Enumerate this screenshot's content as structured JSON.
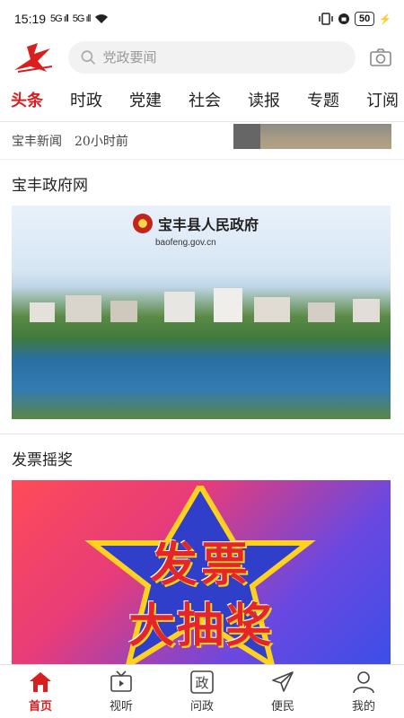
{
  "status_bar": {
    "time": "15:19",
    "signal1": "5G ıll",
    "signal2": "5G ıll",
    "battery": "50"
  },
  "header": {
    "search_placeholder": "党政要闻"
  },
  "tabs": [
    {
      "label": "头条",
      "active": true
    },
    {
      "label": "时政"
    },
    {
      "label": "党建"
    },
    {
      "label": "社会"
    },
    {
      "label": "读报"
    },
    {
      "label": "专题"
    },
    {
      "label": "订阅"
    }
  ],
  "news_item": {
    "source": "宝丰新闻",
    "time": "20小时前"
  },
  "sections": [
    {
      "title": "宝丰政府网",
      "banner_title": "宝丰县人民政府",
      "banner_url": "baofeng.gov.cn"
    },
    {
      "title": "发票摇奖",
      "banner_line1": "发票",
      "banner_line2": "大抽奖"
    }
  ],
  "bottom_nav": [
    {
      "label": "首页",
      "icon": "home-icon",
      "active": true
    },
    {
      "label": "视听",
      "icon": "tv-icon"
    },
    {
      "label": "问政",
      "icon": "zheng-icon"
    },
    {
      "label": "便民",
      "icon": "send-icon"
    },
    {
      "label": "我的",
      "icon": "user-icon"
    }
  ],
  "colors": {
    "accent": "#d81e1e"
  }
}
